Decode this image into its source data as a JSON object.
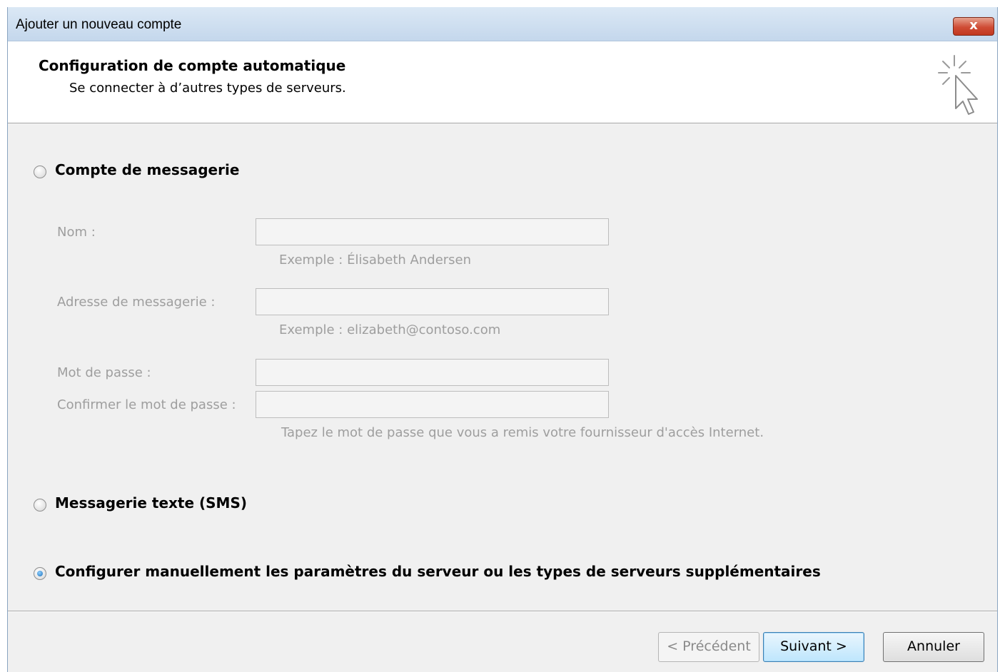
{
  "window": {
    "title": "Ajouter un nouveau compte",
    "close_label": "x"
  },
  "header": {
    "title": "Configuration de compte automatique",
    "subtitle": "Se connecter à d’autres types de serveurs.",
    "icon": "cursor-sparkle-icon"
  },
  "options": {
    "email_account": {
      "label": "Compte de messagerie",
      "checked": false
    },
    "sms": {
      "label": "Messagerie texte (SMS)",
      "checked": false
    },
    "manual": {
      "label": "Configurer manuellement les paramètres du serveur ou les types de serveurs supplémentaires",
      "checked": true
    }
  },
  "form": {
    "name_label": "Nom :",
    "name_value": "",
    "name_hint": "Exemple : Élisabeth Andersen",
    "email_label": "Adresse de messagerie :",
    "email_value": "",
    "email_hint": "Exemple : elizabeth@contoso.com",
    "password_label": "Mot de passe :",
    "password_value": "",
    "confirm_label": "Confirmer le mot de passe :",
    "confirm_value": "",
    "password_hint": "Tapez le mot de passe que vous a remis votre fournisseur d'accès Internet."
  },
  "buttons": {
    "back": "< Précédent",
    "next": "Suivant >",
    "cancel": "Annuler"
  }
}
